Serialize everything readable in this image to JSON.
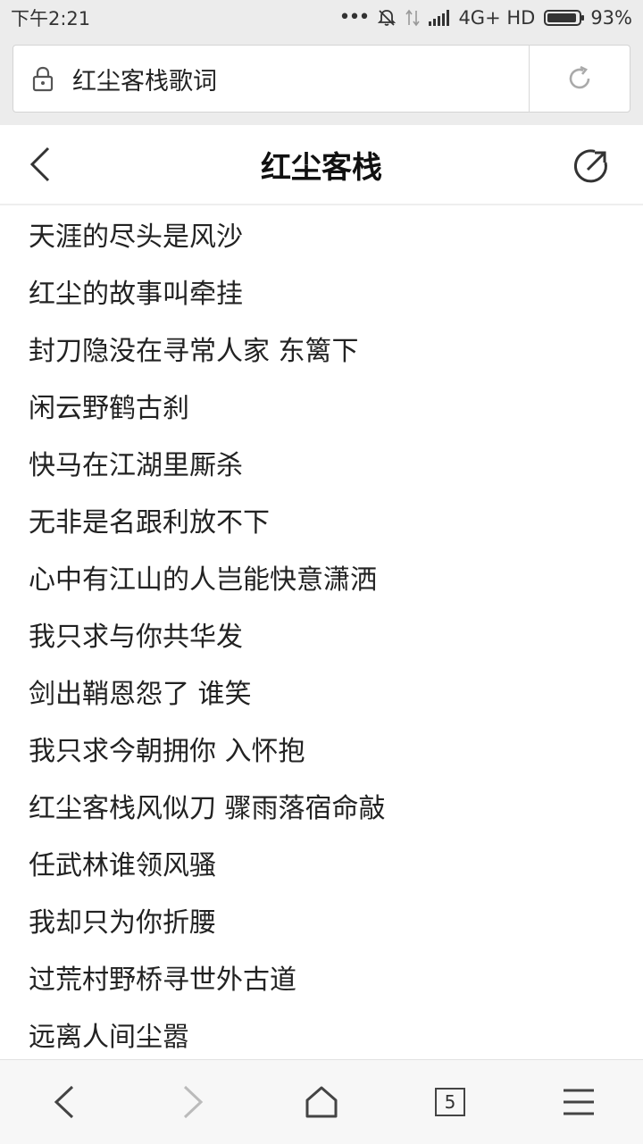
{
  "status": {
    "time": "下午2:21",
    "network": "4G+ HD",
    "battery_level": 0.93,
    "battery_pct": "93%"
  },
  "browser": {
    "url_text": "红尘客栈歌词",
    "tab_count": "5"
  },
  "page": {
    "title": "红尘客栈",
    "lyrics": [
      "天涯的尽头是风沙",
      "红尘的故事叫牵挂",
      "封刀隐没在寻常人家 东篱下",
      "闲云野鹤古刹",
      "快马在江湖里厮杀",
      "无非是名跟利放不下",
      "心中有江山的人岂能快意潇洒",
      "我只求与你共华发",
      "剑出鞘恩怨了 谁笑",
      "我只求今朝拥你 入怀抱",
      "红尘客栈风似刀 骤雨落宿命敲",
      "任武林谁领风骚",
      "我却只为你折腰",
      "过荒村野桥寻世外古道",
      "远离人间尘嚣"
    ]
  },
  "icons": {
    "lock": "lock-icon",
    "reload": "reload-icon",
    "back": "back-arrow-icon",
    "share": "share-icon",
    "nav_back": "chevron-left-icon",
    "nav_forward": "chevron-right-icon",
    "home": "home-icon",
    "menu": "menu-icon"
  }
}
